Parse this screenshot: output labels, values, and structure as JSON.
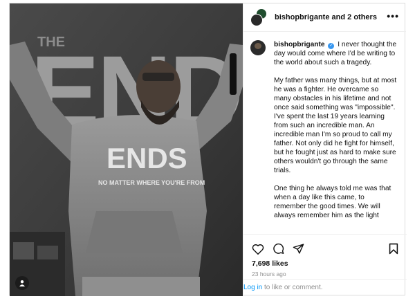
{
  "post": {
    "header": {
      "username": "bishopbrigante",
      "and_text": "and",
      "others": "2 others",
      "more_label": "•••"
    },
    "photo": {
      "alt_icon": "user-tag-icon",
      "backdrop_text": "THE ENDS",
      "shirt_text": "ENDS",
      "shirt_subtext": "NO MATTER WHERE YOU'RE FROM"
    },
    "caption": {
      "username": "bishopbrigante",
      "verified_icon": "verified-badge-icon",
      "p1": "I never thought the day would come where I'd be writing to the world about such a tragedy.",
      "p2": "My father was many things, but at most he was a fighter. He overcame so many obstacles in his lifetime and not once said something was \"impossible\".",
      "p3": "I've spent the last 19 years learning from such an incredible man. An incredible man I'm so proud to call my father. Not only did he fight for himself, but he fought just as hard to make sure others wouldn't go through the same trials.",
      "p4": "One thing he always told me was that when a day like this came, to remember the good times. We will always remember him as the light"
    },
    "actions": {
      "like_icon": "heart-icon",
      "comment_icon": "comment-icon",
      "share_icon": "share-icon",
      "save_icon": "bookmark-icon",
      "likes": "7,698 likes",
      "time": "23 hours ago"
    },
    "footer": {
      "login_link": "Log in",
      "login_rest": " to like or comment."
    }
  }
}
